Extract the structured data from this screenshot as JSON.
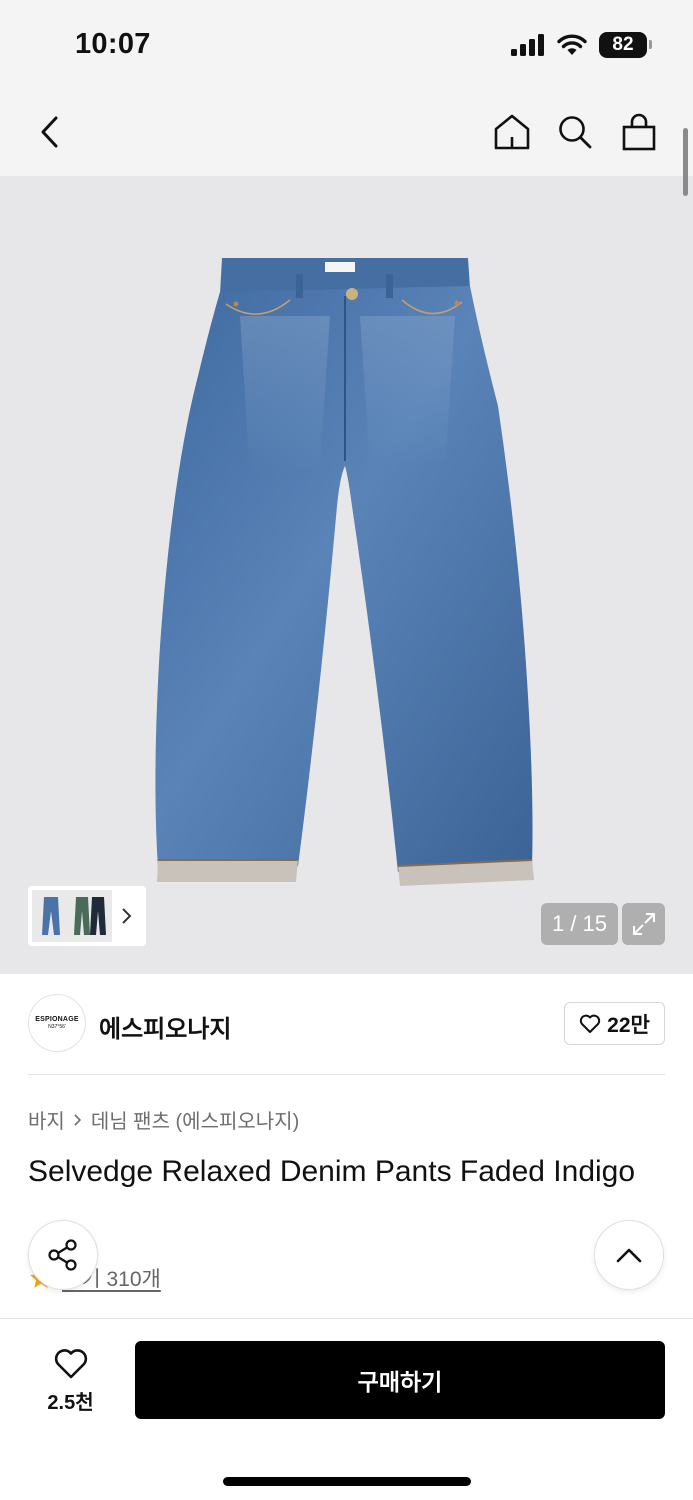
{
  "status_bar": {
    "time": "10:07",
    "battery": "82"
  },
  "nav": {
    "back_icon": "chevron-left-icon",
    "home_icon": "home-icon",
    "search_icon": "search-icon",
    "bag_icon": "shopping-bag-icon"
  },
  "gallery": {
    "page": "1 / 15",
    "expand_icon": "expand-icon",
    "thumb_next_icon": "chevron-right-icon"
  },
  "brand": {
    "logo_line1": "ESPIONAGE",
    "logo_line2": "N37°56'",
    "name": "에스피오나지",
    "likes": "22만"
  },
  "breadcrumb": {
    "category": "바지",
    "subcategory": "데님 팬츠 (에스피오나지)"
  },
  "product": {
    "title": "Selvedge Relaxed Denim Pants Faded Indigo"
  },
  "rating": {
    "review_link": "후기 310개",
    "star_color": "#f5a623"
  },
  "actions": {
    "wish_count": "2.5천",
    "buy_label": "구매하기"
  },
  "colors": {
    "denim": "#4a74a8",
    "button": "#000000",
    "image_bg": "#e7e7e9"
  }
}
